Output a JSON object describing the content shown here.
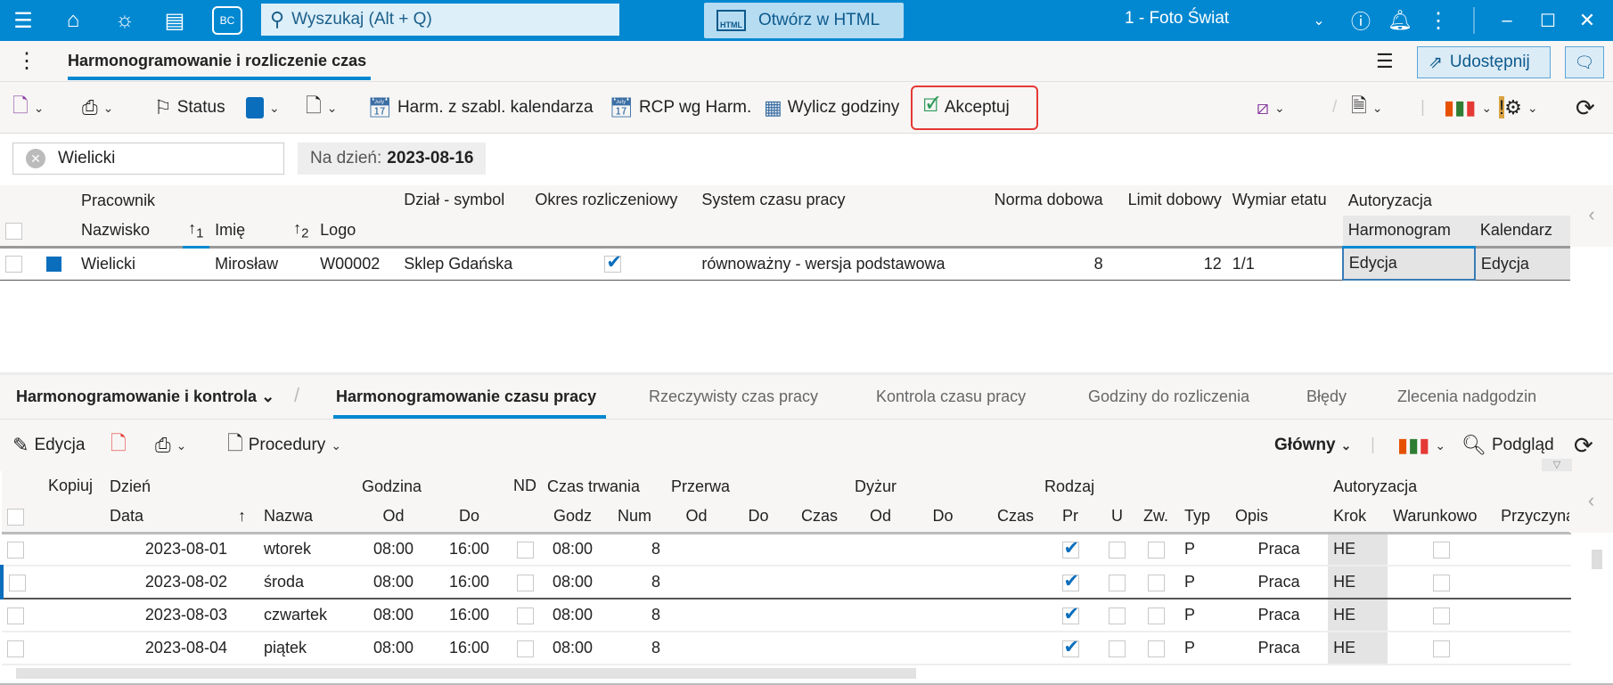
{
  "titlebar": {
    "search_placeholder": "Wyszukaj (Alt + Q)",
    "open_html": "Otwórz w HTML",
    "company": "1 - Foto Świat",
    "html_icon_text": "HTML",
    "bc_icon_text": "BC"
  },
  "tabs": {
    "active": "Harmonogramowanie i rozliczenie czas",
    "share": "Udostępnij"
  },
  "toolbar": {
    "status": "Status",
    "harm_template": "Harm. z szabl. kalendarza",
    "rcp": "RCP wg Harm.",
    "compute": "Wylicz godziny",
    "accept": "Akceptuj",
    "status_color": "#0a6ebd",
    "accept_highlight": "#e53935"
  },
  "filter": {
    "search_value": "Wielicki",
    "date_label": "Na dzień:",
    "date_value": "2023-08-16"
  },
  "upper_grid": {
    "group_headers": {
      "employee": "Pracownik",
      "authorization": "Autoryzacja"
    },
    "columns": {
      "surname": "Nazwisko",
      "sort1": "1",
      "name": "Imię",
      "sort2": "2",
      "logo": "Logo",
      "dept": "Dział - symbol",
      "period": "Okres rozliczeniowy",
      "system": "System czasu pracy",
      "norm": "Norma dobowa",
      "limit": "Limit dobowy",
      "fte": "Wymiar etatu",
      "schedule": "Harmonogram",
      "calendar": "Kalendarz"
    },
    "rows": [
      {
        "surname": "Wielicki",
        "name": "Mirosław",
        "logo": "W00002",
        "dept": "Sklep Gdańska",
        "period_checked": true,
        "system": "równoważny - wersja podstawowa",
        "norm": "8",
        "limit": "12",
        "fte": "1/1",
        "schedule": "Edycja",
        "calendar": "Edycja"
      }
    ]
  },
  "lower_tabs": {
    "group": "Harmonogramowanie i kontrola",
    "items": [
      "Harmonogramowanie czasu pracy",
      "Rzeczywisty czas pracy",
      "Kontrola czasu pracy",
      "Godziny do rozliczenia",
      "Błędy",
      "Zlecenia nadgodzin"
    ],
    "active_index": 0
  },
  "lower_toolbar": {
    "edit": "Edycja",
    "procedures": "Procedury",
    "view_select": "Główny",
    "preview": "Podgląd"
  },
  "lower_grid": {
    "group_headers": {
      "copy": "Kopiuj",
      "day": "Dzień",
      "hour": "Godzina",
      "nd": "ND",
      "duration": "Czas trwania",
      "break": "Przerwa",
      "duty": "Dyżur",
      "kind": "Rodzaj",
      "auth": "Autoryzacja"
    },
    "columns": {
      "date": "Data",
      "dname": "Nazwa",
      "from": "Od",
      "to": "Do",
      "godz": "Godz",
      "num": "Num",
      "b_from": "Od",
      "b_to": "Do",
      "b_time": "Czas",
      "d_from": "Od",
      "d_to": "Do",
      "d_time": "Czas",
      "pr": "Pr",
      "u": "U",
      "zw": "Zw.",
      "typ": "Typ",
      "opis": "Opis",
      "krok": "Krok",
      "cond": "Warunkowo",
      "reason": "Przyczyna"
    },
    "rows": [
      {
        "date": "2023-08-01",
        "dname": "wtorek",
        "from": "08:00",
        "to": "16:00",
        "godz": "08:00",
        "num": "8",
        "typ": "P",
        "opis": "Praca",
        "krok": "HE"
      },
      {
        "date": "2023-08-02",
        "dname": "środa",
        "from": "08:00",
        "to": "16:00",
        "godz": "08:00",
        "num": "8",
        "typ": "P",
        "opis": "Praca",
        "krok": "HE"
      },
      {
        "date": "2023-08-03",
        "dname": "czwartek",
        "from": "08:00",
        "to": "16:00",
        "godz": "08:00",
        "num": "8",
        "typ": "P",
        "opis": "Praca",
        "krok": "HE"
      },
      {
        "date": "2023-08-04",
        "dname": "piątek",
        "from": "08:00",
        "to": "16:00",
        "godz": "08:00",
        "num": "8",
        "typ": "P",
        "opis": "Praca",
        "krok": "HE"
      }
    ]
  }
}
